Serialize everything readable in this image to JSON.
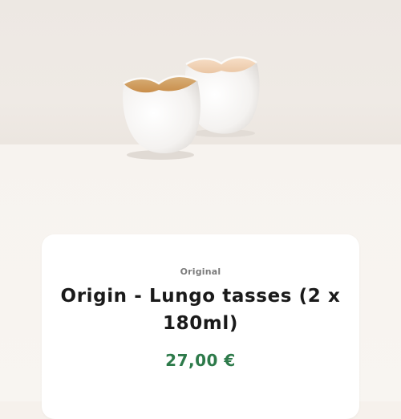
{
  "product": {
    "image_alt": "Origin lungo cups pair",
    "category": "Original",
    "name": "Origin - Lungo tasses (2 x 180ml)",
    "price": "27,00 €"
  },
  "colors": {
    "price_green": "#2d7a4a",
    "title": "#1a1a1a",
    "subtitle": "#7b7b7b",
    "background": "#f6f1ec"
  }
}
